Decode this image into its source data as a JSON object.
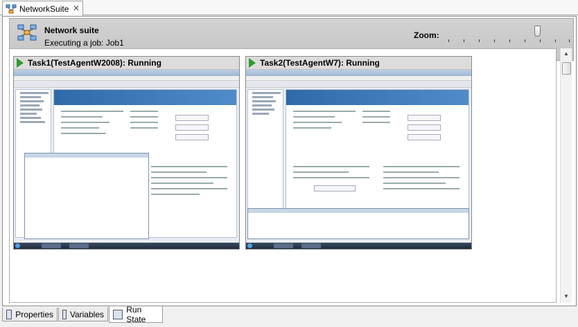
{
  "document_tab": {
    "label": "NetworkSuite",
    "close": "✕"
  },
  "header": {
    "title": "Network suite",
    "subtitle": "Executing a job: Job1",
    "zoom_label": "Zoom:"
  },
  "tasks": [
    {
      "title": "Task1(TestAgentW2008): Running"
    },
    {
      "title": "Task2(TestAgentW7): Running"
    }
  ],
  "bottom_tabs": [
    {
      "label": "Properties"
    },
    {
      "label": "Variables"
    },
    {
      "label": "Run State",
      "active": true
    }
  ],
  "colors": {
    "running_indicator": "#2e9b2e",
    "header_bg": "#c8c8c8"
  }
}
